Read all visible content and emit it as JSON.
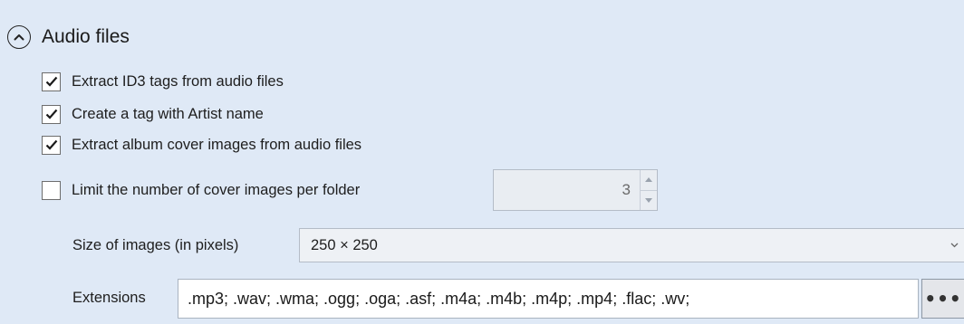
{
  "section": {
    "title": "Audio files",
    "collapse_icon": "chevron-up-circle-icon"
  },
  "options": [
    {
      "label": "Extract ID3 tags from audio files",
      "checked": true
    },
    {
      "label": "Create a tag with Artist name",
      "checked": true
    },
    {
      "label": "Extract album cover images from audio files",
      "checked": true
    },
    {
      "label": "Limit the number of cover images per folder",
      "checked": false
    }
  ],
  "limit_spinner": {
    "value": "3",
    "enabled": false
  },
  "image_size": {
    "label": "Size of images (in pixels)",
    "selected": "250 × 250"
  },
  "extensions": {
    "label": "Extensions",
    "value": ".mp3; .wav; .wma; .ogg; .oga; .asf; .m4a; .m4b; .m4p; .mp4; .flac; .wv;",
    "browse_label": "•••"
  },
  "colors": {
    "panel_background": "#dfe9f6",
    "checkbox_border": "#6d6d6d",
    "disabled_text": "#6a6a6a"
  }
}
